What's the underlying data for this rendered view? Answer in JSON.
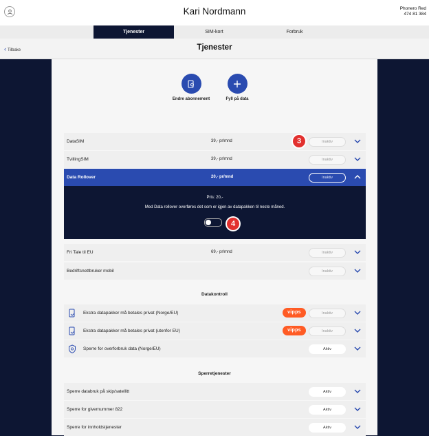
{
  "header": {
    "user_name": "Kari Nordmann",
    "plan_name": "Phonero Red",
    "phone": "474 81 384"
  },
  "tabs": [
    {
      "label": "Tjenester",
      "active": true
    },
    {
      "label": "SIM-kort",
      "active": false
    },
    {
      "label": "Forbruk",
      "active": false
    }
  ],
  "subheader": {
    "back_label": "Tilbake",
    "title": "Tjenester"
  },
  "actions": [
    {
      "label": "Endre abonnement",
      "icon": "card-edit-icon"
    },
    {
      "label": "Fyll på data",
      "icon": "plus-icon"
    }
  ],
  "services": [
    {
      "name": "DataSIM",
      "price": "39,- pr/mnd",
      "status": "Inaktiv"
    },
    {
      "name": "TvillingSIM",
      "price": "39,- pr/mnd",
      "status": "Inaktiv"
    },
    {
      "name": "Data Rollover",
      "price": "20,- pr/mnd",
      "status": "Inaktiv",
      "expanded": true
    },
    {
      "name": "Fri Tale til EU",
      "price": "69,- pr/mnd",
      "status": "Inaktiv"
    },
    {
      "name": "Bedriftsnettbruker mobil",
      "price": "",
      "status": "Inaktiv"
    }
  ],
  "expanded_detail": {
    "price_text": "Pris: 20,-",
    "description": "Med Data rollover overføres det som er igjen av datapakken til neste måned.",
    "switch_on": false
  },
  "datakontroll": {
    "heading": "Datakontroll",
    "items": [
      {
        "name": "Ekstra datapakker må betales privat (Norge/EU)",
        "vipps": "vipps",
        "status": "Inaktiv",
        "icon": "phone-doc-icon"
      },
      {
        "name": "Ekstra datapakker må betales privat (utenfor EU)",
        "vipps": "vipps",
        "status": "Inaktiv",
        "icon": "phone-doc-icon"
      },
      {
        "name": "Sperre for overforbruk data (Norge/EU)",
        "status": "Aktiv",
        "icon": "shield-icon"
      }
    ]
  },
  "sperretjenester": {
    "heading": "Sperretjenester",
    "items": [
      {
        "name": "Sperre databruk på skip/satellitt",
        "status": "Aktiv"
      },
      {
        "name": "Sperre for givernummer 822",
        "status": "Aktiv"
      },
      {
        "name": "Sperre for innholdstjenester",
        "status": "Aktiv"
      }
    ]
  },
  "badges": [
    "3",
    "4"
  ],
  "colors": {
    "navy": "#0d1633",
    "accent": "#2a4bb0",
    "badge_red": "#e2302e",
    "vipps": "#ff5b24"
  }
}
